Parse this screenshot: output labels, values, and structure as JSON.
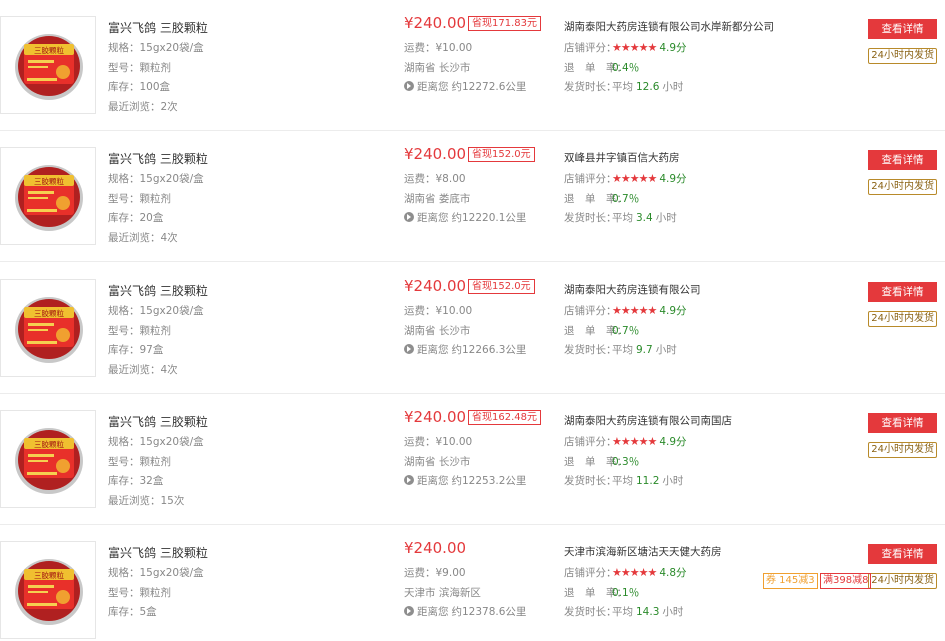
{
  "labels": {
    "spec": "规格：",
    "model": "型号：",
    "stock": "库存：",
    "recent": "最近浏览：",
    "freight": "运费：",
    "distance": "距离您",
    "rating": "店铺评分：",
    "refund": "退　单　率：",
    "ship_time": "发货时长：",
    "avg": "平均",
    "hours": "小时",
    "detail_button": "查看详情",
    "ship_badge": "24小时内发货",
    "stars": "★★★★★",
    "box_label": "三胶颗粒"
  },
  "colors": {
    "accent": "#e4393c",
    "green": "#2a8a2a"
  },
  "items": [
    {
      "name": "富兴飞鸽 三胶颗粒",
      "spec": "15gx20袋/盒",
      "model": "颗粒剂",
      "stock": "100盒",
      "recent": "2次",
      "price": "¥240.00",
      "save": "省现171.83元",
      "freight": "¥10.00",
      "region": "湖南省 长沙市",
      "distance": "约12272.6公里",
      "shop": "湖南泰阳大药房连锁有限公司水岸新都分公司",
      "score": "4.9分",
      "refund": "0.4％",
      "ship_hours": "12.6",
      "coupons": []
    },
    {
      "name": "富兴飞鸽 三胶颗粒",
      "spec": "15gx20袋/盒",
      "model": "颗粒剂",
      "stock": "20盒",
      "recent": "4次",
      "price": "¥240.00",
      "save": "省现152.0元",
      "freight": "¥8.00",
      "region": "湖南省 娄底市",
      "distance": "约12220.1公里",
      "shop": "双峰县井字镇百信大药房",
      "score": "4.9分",
      "refund": "0.7％",
      "ship_hours": "3.4",
      "coupons": []
    },
    {
      "name": "富兴飞鸽 三胶颗粒",
      "spec": "15gx20袋/盒",
      "model": "颗粒剂",
      "stock": "97盒",
      "recent": "4次",
      "price": "¥240.00",
      "save": "省现152.0元",
      "freight": "¥10.00",
      "region": "湖南省 长沙市",
      "distance": "约12266.3公里",
      "shop": "湖南泰阳大药房连锁有限公司",
      "score": "4.9分",
      "refund": "0.7％",
      "ship_hours": "9.7",
      "coupons": []
    },
    {
      "name": "富兴飞鸽 三胶颗粒",
      "spec": "15gx20袋/盒",
      "model": "颗粒剂",
      "stock": "32盒",
      "recent": "15次",
      "price": "¥240.00",
      "save": "省现162.48元",
      "freight": "¥10.00",
      "region": "湖南省 长沙市",
      "distance": "约12253.2公里",
      "shop": "湖南泰阳大药房连锁有限公司南国店",
      "score": "4.9分",
      "refund": "0.3％",
      "ship_hours": "11.2",
      "coupons": []
    },
    {
      "name": "富兴飞鸽 三胶颗粒",
      "spec": "15gx20袋/盒",
      "model": "颗粒剂",
      "stock": "5盒",
      "recent": "",
      "price": "¥240.00",
      "save": "",
      "freight": "¥9.00",
      "region": "天津市 滨海新区",
      "distance": "约12378.6公里",
      "shop": "天津市滨海新区塘沽天天健大药房",
      "score": "4.8分",
      "refund": "0.1％",
      "ship_hours": "14.3",
      "coupons": [
        "券 145减3",
        "满398减8"
      ]
    }
  ]
}
